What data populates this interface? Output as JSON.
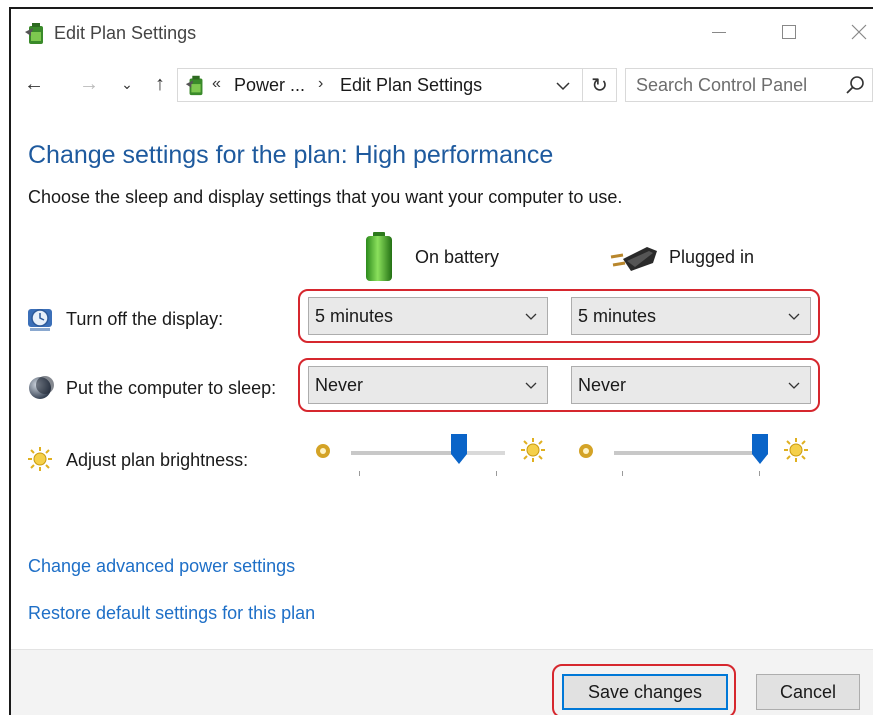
{
  "window": {
    "title": "Edit Plan Settings",
    "controls": {
      "minimize": "minimize-icon",
      "maximize": "maximize-icon",
      "close": "close-icon"
    }
  },
  "navigation": {
    "back": "←",
    "forward": "→",
    "recent": "⌄",
    "up": "↑",
    "breadcrumb": {
      "prefix": "«",
      "parent": "Power ...",
      "separator": "›",
      "current": "Edit Plan Settings"
    },
    "refresh": "↻",
    "search_placeholder": "Search Control Panel"
  },
  "page": {
    "heading": "Change settings for the plan: High performance",
    "subheading": "Choose the sleep and display settings that you want your computer to use.",
    "columns": {
      "battery": "On battery",
      "plugged": "Plugged in"
    },
    "rows": {
      "display": {
        "label": "Turn off the display:",
        "battery": "5 minutes",
        "plugged": "5 minutes"
      },
      "sleep": {
        "label": "Put the computer to sleep:",
        "battery": "Never",
        "plugged": "Never"
      },
      "brightness": {
        "label": "Adjust plan brightness:",
        "battery_level": 0.7,
        "plugged_level": 1.0
      }
    },
    "links": {
      "advanced": "Change advanced power settings",
      "restore": "Restore default settings for this plan"
    }
  },
  "footer": {
    "save": "Save changes",
    "cancel": "Cancel"
  },
  "colors": {
    "heading": "#1e5a9e",
    "link": "#1e6fc7",
    "highlight": "#d6272e",
    "slider_thumb": "#0a64c8"
  }
}
